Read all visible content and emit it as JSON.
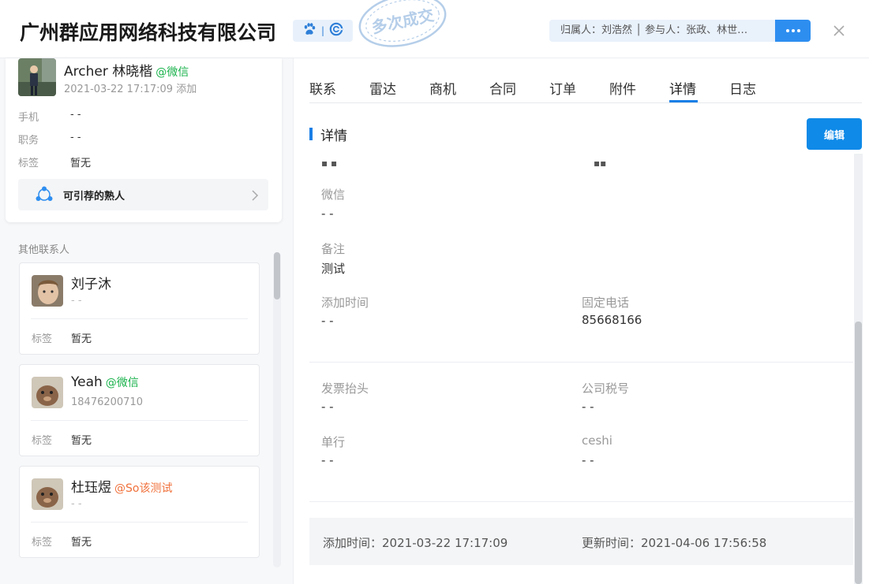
{
  "header": {
    "company": "广州群应用网络科技有限公司",
    "stamp": "多次成交",
    "owner_text": "归属人：刘浩然 │ 参与人：张政、林世…",
    "colors": {
      "accent": "#2e8ef0",
      "wechat": "#19b24b"
    }
  },
  "primary_contact": {
    "name": "Archer 林晓楷",
    "source": "@微信",
    "added": "2021-03-22 17:17:09 添加",
    "fields": [
      {
        "label": "手机",
        "value": "- -"
      },
      {
        "label": "职务",
        "value": "- -"
      },
      {
        "label": "标签",
        "value": "暂无"
      }
    ],
    "referral_label": "可引荐的熟人"
  },
  "other_contacts": {
    "label": "其他联系人",
    "items": [
      {
        "name": "刘子沐",
        "source": "",
        "phone": "- -",
        "tag_label": "标签",
        "tag_value": "暂无"
      },
      {
        "name": "Yeah",
        "source": "@微信",
        "phone": "18476200710",
        "tag_label": "标签",
        "tag_value": "暂无"
      },
      {
        "name": "杜珏煜",
        "source": "@So该测试",
        "phone": "- -",
        "tag_label": "标签",
        "tag_value": "暂无"
      }
    ]
  },
  "tabs": [
    "联系",
    "雷达",
    "商机",
    "合同",
    "订单",
    "附件",
    "详情",
    "日志"
  ],
  "active_tab": "详情",
  "detail": {
    "title": "详情",
    "edit_label": "编辑",
    "fields": [
      {
        "label": "微信",
        "value": "- -"
      },
      {
        "label": "备注",
        "value": "测试"
      },
      {
        "label": "添加时间",
        "value": "- -"
      },
      {
        "label": "固定电话",
        "value": "85668166"
      },
      {
        "label": "发票抬头",
        "value": "- -"
      },
      {
        "label": "公司税号",
        "value": "- -"
      },
      {
        "label": "单行",
        "value": "- -"
      },
      {
        "label": "ceshi",
        "value": "- -"
      }
    ],
    "footer": {
      "added_label": "添加时间：",
      "added_value": "2021-03-22 17:17:09",
      "updated_label": "更新时间：",
      "updated_value": "2021-04-06 17:56:58"
    }
  }
}
